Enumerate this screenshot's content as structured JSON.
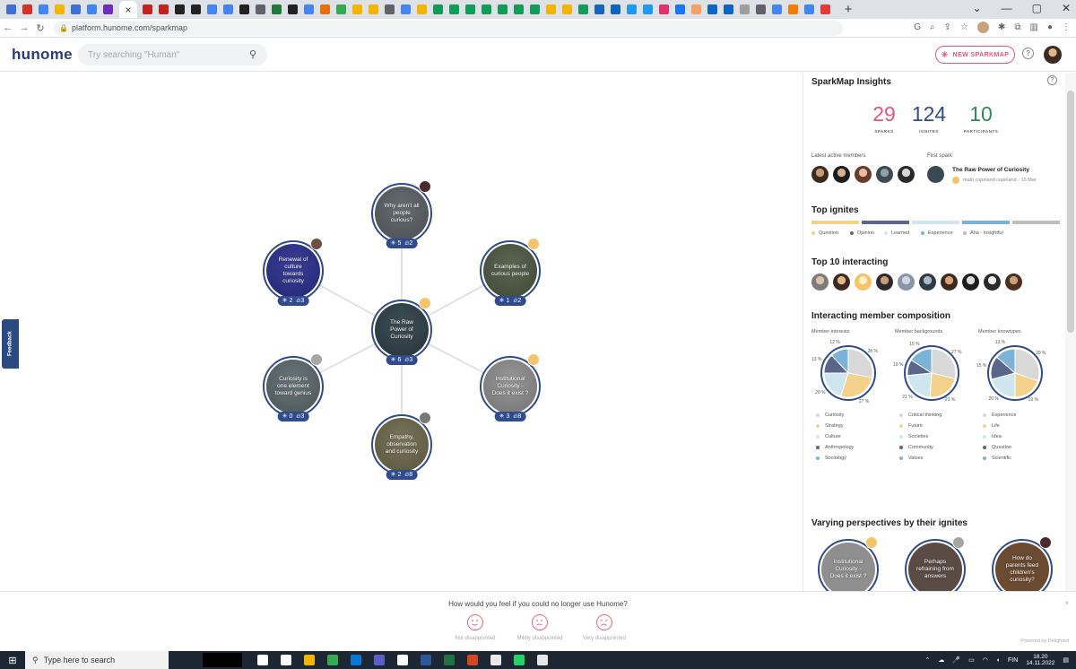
{
  "browser": {
    "url": "platform.hunome.com/sparkmap",
    "close_tab": "×",
    "new_tab": "+",
    "tab_icon_colors": [
      "#3d6fd6",
      "#d93025",
      "#4285f4",
      "#f4b400",
      "#3d6fd6",
      "#4285f4",
      "#6f2dbd",
      "#c5221f",
      "#c5221f",
      "#222222",
      "#222222",
      "#4285f4",
      "#4285f4",
      "#222222",
      "#5f6368",
      "#1f7a3a",
      "#222222",
      "#4285f4",
      "#e8710a",
      "#34a853",
      "#f4b400",
      "#f4b400",
      "#5f6368",
      "#4285f4",
      "#f4b400",
      "#0f9d58",
      "#0f9d58",
      "#0f9d58",
      "#0f9d58",
      "#0f9d58",
      "#0f9d58",
      "#0f9d58",
      "#f4b400",
      "#f4b400",
      "#0f9d58",
      "#1565c0",
      "#0a66c2",
      "#1d9bf0",
      "#1d9bf0",
      "#e1306c",
      "#1877f2",
      "#f4a261",
      "#0a66c2",
      "#0a66c2",
      "#9e9e9e",
      "#5f6368",
      "#4285f4",
      "#f57c00",
      "#4285f4",
      "#e53935"
    ]
  },
  "header": {
    "logo": "hunome",
    "search_placeholder": "Try searching \"Human\"",
    "new_spark_label": "NEW SPARKMAP",
    "help_glyph": "?"
  },
  "feedback_tab": "Feedback",
  "map": {
    "center": {
      "title": "The Raw Power of Curiosity",
      "sparks": "6",
      "ignites": "3",
      "bg": "#2f3f48"
    },
    "nodes": [
      {
        "id": "top",
        "title": "Why aren't all people curious?",
        "sparks": "5",
        "ignites": "2",
        "bg": "#5b6166",
        "owner": "#4a2c2c"
      },
      {
        "id": "upper-left",
        "title": "Renewal of culture towards curiosity",
        "sparks": "2",
        "ignites": "3",
        "bg": "#2b2f8f",
        "owner": "#6d5140"
      },
      {
        "id": "upper-right",
        "title": "Examples of curious people",
        "sparks": "1",
        "ignites": "2",
        "bg": "#4e5a43",
        "owner": "#f5c46a"
      },
      {
        "id": "lower-left",
        "title": "Curiosity is one element toward genius",
        "sparks": "0",
        "ignites": "3",
        "bg": "#5d6a6e",
        "owner": "#a8a6a0"
      },
      {
        "id": "lower-right",
        "title": "Institutional Curiosity - Does it exist ?",
        "sparks": "3",
        "ignites": "8",
        "bg": "#8f8f8f",
        "owner": "#f5c46a"
      },
      {
        "id": "bottom",
        "title": "Empathy, observation and curiosity",
        "sparks": "2",
        "ignites": "8",
        "bg": "#6e6a4e",
        "owner": "#777777"
      }
    ]
  },
  "insights": {
    "title": "SparkMap Insights",
    "stats": [
      {
        "value": "29",
        "label": "SPARKS",
        "color": "#e4567a"
      },
      {
        "value": "124",
        "label": "IGNITES",
        "color": "#2f4b8e"
      },
      {
        "value": "10",
        "label": "PARTICIPANTS",
        "color": "#2e8b57"
      }
    ],
    "latest_members_label": "Latest active members",
    "first_spark_label": "First spark",
    "first_spark_title": "The Raw Power of Curiosity",
    "first_spark_meta": "matti copeland copeland - 15 Mar",
    "top_ignites_title": "Top ignites",
    "ignite_legend": [
      {
        "label": "Question",
        "color": "#f5d28c"
      },
      {
        "label": "Opinion",
        "color": "#5a6689"
      },
      {
        "label": "Learned",
        "color": "#cfe6f0"
      },
      {
        "label": "Experience",
        "color": "#7bb3d8"
      },
      {
        "label": "Aha - Insightful",
        "color": "#bdbdbd"
      }
    ],
    "top10_title": "Top 10 interacting",
    "composition_title": "Interacting member composition",
    "pies": [
      {
        "title": "Member interests",
        "values": [
          28,
          27,
          20,
          13,
          12
        ],
        "colors": [
          "#d8d8d8",
          "#f5d28c",
          "#cfe6f0",
          "#5a6689",
          "#7bb3d8"
        ],
        "legend": [
          "Curiosity",
          "Strategy",
          "Culture",
          "Anthropology",
          "Sociology"
        ],
        "pct_labels": [
          "28 %",
          "27 %",
          "20 %",
          "13 %",
          "12 %"
        ]
      },
      {
        "title": "Member backgrounds",
        "values": [
          27,
          21,
          21,
          10,
          15
        ],
        "colors": [
          "#d8d8d8",
          "#f5d28c",
          "#cfe6f0",
          "#5a6689",
          "#7bb3d8"
        ],
        "legend": [
          "Critical thinking",
          "Future",
          "Societies",
          "Community",
          "Values"
        ],
        "pct_labels": [
          "27 %",
          "21 %",
          "21 %",
          "10 %",
          "15 %"
        ]
      },
      {
        "title": "Member knowtypes",
        "values": [
          29,
          19,
          20,
          15,
          13
        ],
        "colors": [
          "#d8d8d8",
          "#f5d28c",
          "#cfe6f0",
          "#5a6689",
          "#7bb3d8"
        ],
        "legend": [
          "Experience",
          "Life",
          "Idea",
          "Question",
          "Scientific"
        ],
        "pct_labels": [
          "29 %",
          "19 %",
          "20 %",
          "15 %",
          "13 %"
        ]
      }
    ],
    "perspectives_title": "Varying perspectives by their ignites",
    "perspectives": [
      {
        "title": "Institutional Curiosity - Does it exist ?",
        "bg": "#8f8f8f",
        "owner": "#f5c46a"
      },
      {
        "title": "Perhaps refraining from answers",
        "bg": "#5a4c44",
        "owner": "#a8a6a0"
      },
      {
        "title": "How do parents feed children's curiosity?",
        "bg": "#6a4a30",
        "owner": "#4a2c2c"
      }
    ]
  },
  "survey": {
    "question": "How would you feel if you could no longer use Hunome?",
    "options": [
      "Not disappointed",
      "Mildly disappointed",
      "Very disappointed"
    ],
    "close": "×",
    "powered": "Powered by Delighted"
  },
  "taskbar": {
    "search_placeholder": "Type here to search",
    "lang": "FIN",
    "time": "18.20",
    "date": "14.11.2022",
    "app_colors": [
      "#ffffff",
      "#ffffff",
      "#f4b400",
      "#34a853",
      "#0078d4",
      "#5b5fc7",
      "#ffffff",
      "#2b579a",
      "#217346",
      "#d24726",
      "#e8e8e8",
      "#25d366",
      "#e6e6e6"
    ]
  }
}
